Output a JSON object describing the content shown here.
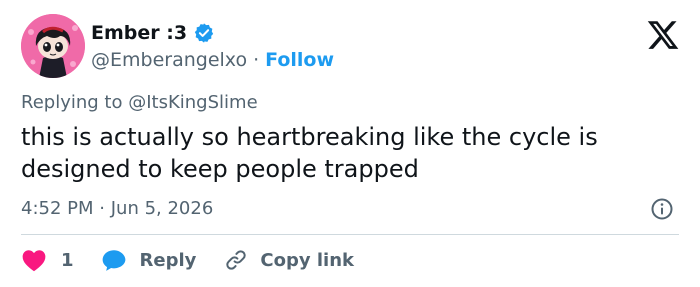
{
  "author": {
    "display_name": "Ember :3",
    "handle": "@Emberangelxo",
    "separator": "·",
    "follow_label": "Follow"
  },
  "reply_context": {
    "prefix": "Replying to",
    "mention": "@ItsKingSlime"
  },
  "tweet": {
    "text": "this is actually so heartbreaking like the cycle is designed to keep people trapped",
    "time": "4:52 PM",
    "separator": "·",
    "date": "Jun 5, 2026"
  },
  "actions": {
    "like_count": "1",
    "reply_label": "Reply",
    "copy_link_label": "Copy link"
  },
  "colors": {
    "accent": "#1d9bf0",
    "like": "#f91880",
    "muted": "#536471",
    "text": "#0f1419"
  },
  "icons": [
    "verified-badge-icon",
    "x-logo-icon",
    "info-icon",
    "heart-icon",
    "reply-bubble-icon",
    "link-icon"
  ]
}
